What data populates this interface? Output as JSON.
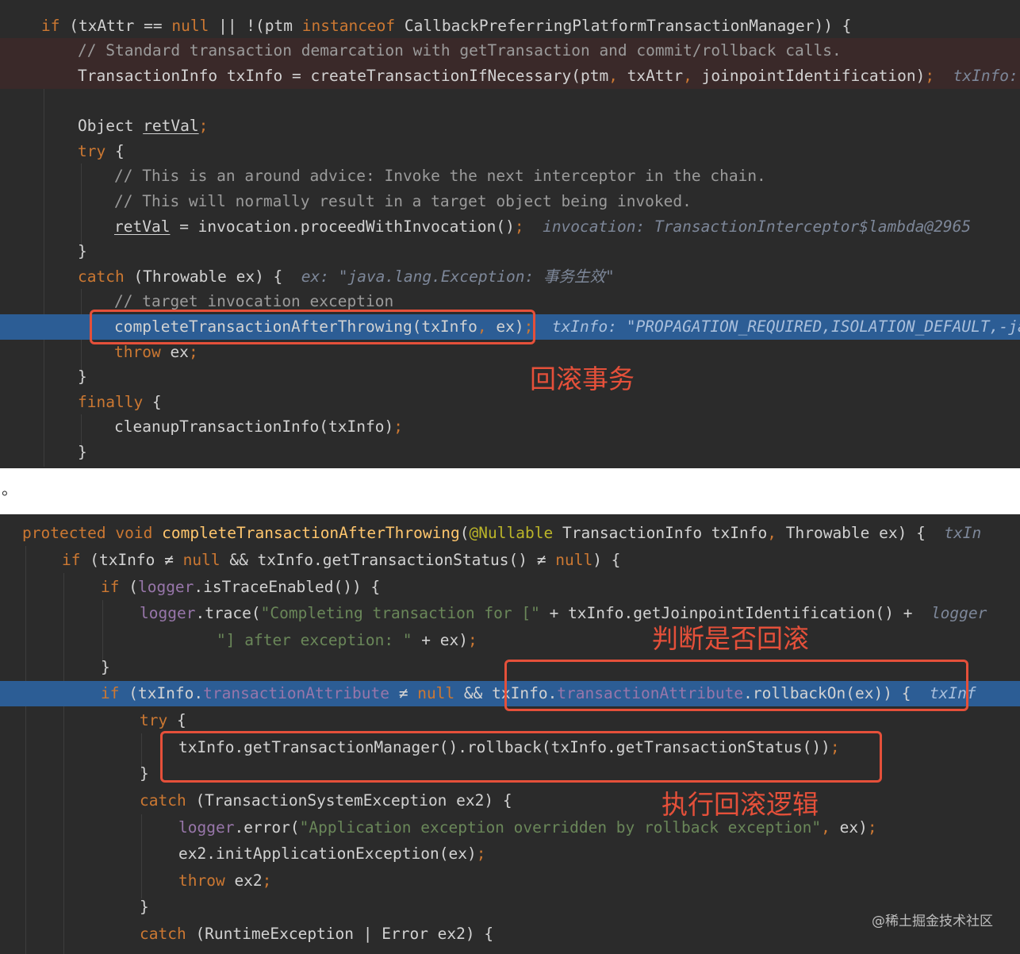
{
  "top_panel": {
    "lines": [
      [
        {
          "t": "if",
          "c": "kw"
        },
        {
          "t": " (txAttr == "
        },
        {
          "t": "null",
          "c": "kw"
        },
        {
          "t": " || !(ptm "
        },
        {
          "t": "instanceof",
          "c": "kw"
        },
        {
          "t": " CallbackPreferringPlatformTransactionManager)) {"
        }
      ],
      [
        {
          "t": "// Standard transaction demarcation with getTransaction and commit/rollback calls.",
          "c": "cm"
        }
      ],
      [
        {
          "t": "TransactionInfo txInfo = createTransactionIfNecessary(ptm"
        },
        {
          "t": ",",
          "c": "kw"
        },
        {
          "t": " txAttr"
        },
        {
          "t": ",",
          "c": "kw"
        },
        {
          "t": " joinpointIdentification)"
        },
        {
          "t": ";",
          "c": "kw"
        },
        {
          "t": "  txInfo: \"",
          "c": "hint"
        }
      ],
      [],
      [
        {
          "t": "Object "
        },
        {
          "t": "retVal",
          "c": "ul"
        },
        {
          "t": ";",
          "c": "kw"
        }
      ],
      [
        {
          "t": "try",
          "c": "kw"
        },
        {
          "t": " {"
        }
      ],
      [
        {
          "t": "// This is an around advice: Invoke the next interceptor in the chain.",
          "c": "cm"
        }
      ],
      [
        {
          "t": "// This will normally result in a target object being invoked.",
          "c": "cm"
        }
      ],
      [
        {
          "t": "retVal",
          "c": "ul"
        },
        {
          "t": " = invocation.proceedWithInvocation()"
        },
        {
          "t": ";",
          "c": "kw"
        },
        {
          "t": "  invocation: TransactionInterceptor$lambda@2965",
          "c": "hint"
        }
      ],
      [
        {
          "t": "}"
        }
      ],
      [
        {
          "t": "catch",
          "c": "kw"
        },
        {
          "t": " (Throwable ex) {  "
        },
        {
          "t": "ex: \"java.lang.Exception: 事务生效\"",
          "c": "hint"
        }
      ],
      [
        {
          "t": "// target invocation exception",
          "c": "cm"
        }
      ],
      [
        {
          "t": "completeTransactionAfterThrowing(txInfo"
        },
        {
          "t": ",",
          "c": "kw"
        },
        {
          "t": " ex)"
        },
        {
          "t": ";",
          "c": "kw"
        },
        {
          "t": "  txInfo: \"PROPAGATION_REQUIRED,ISOLATION_DEFAULT,-java",
          "c": "hint"
        }
      ],
      [
        {
          "t": "throw",
          "c": "kw"
        },
        {
          "t": " ex"
        },
        {
          "t": ";",
          "c": "kw"
        }
      ],
      [
        {
          "t": "}"
        }
      ],
      [
        {
          "t": "finally",
          "c": "kw"
        },
        {
          "t": " {"
        }
      ],
      [
        {
          "t": "cleanupTransactionInfo(txInfo)"
        },
        {
          "t": ";",
          "c": "kw"
        }
      ],
      [
        {
          "t": "}"
        }
      ]
    ]
  },
  "separator": "。",
  "bottom_panel": {
    "lines": [
      [
        {
          "t": "protected void ",
          "c": "kw"
        },
        {
          "t": "completeTransactionAfterThrowing",
          "c": "fn"
        },
        {
          "t": "("
        },
        {
          "t": "@Nullable",
          "c": "an"
        },
        {
          "t": " TransactionInfo txInfo"
        },
        {
          "t": ",",
          "c": "kw"
        },
        {
          "t": " Throwable ex) {  "
        },
        {
          "t": "txIn",
          "c": "hint"
        }
      ],
      [
        {
          "t": "if",
          "c": "kw"
        },
        {
          "t": " (txInfo ≠ "
        },
        {
          "t": "null",
          "c": "kw"
        },
        {
          "t": " && txInfo.getTransactionStatus() ≠ "
        },
        {
          "t": "null",
          "c": "kw"
        },
        {
          "t": ") {"
        }
      ],
      [
        {
          "t": "if",
          "c": "kw"
        },
        {
          "t": " ("
        },
        {
          "t": "logger",
          "c": "fld"
        },
        {
          "t": ".isTraceEnabled()) {"
        }
      ],
      [
        {
          "t": "logger",
          "c": "fld"
        },
        {
          "t": ".trace("
        },
        {
          "t": "\"Completing transaction for [\"",
          "c": "str"
        },
        {
          "t": " + txInfo.getJoinpointIdentification() +  "
        },
        {
          "t": "logger",
          "c": "hint"
        }
      ],
      [
        {
          "t": "\"] after exception: \"",
          "c": "str"
        },
        {
          "t": " + ex)"
        },
        {
          "t": ";",
          "c": "kw"
        }
      ],
      [
        {
          "t": "}"
        }
      ],
      [
        {
          "t": "if",
          "c": "kw"
        },
        {
          "t": " (txInfo."
        },
        {
          "t": "transactionAttribute",
          "c": "fld"
        },
        {
          "t": " ≠ "
        },
        {
          "t": "null",
          "c": "kw"
        },
        {
          "t": " && txInfo."
        },
        {
          "t": "transactionAttribute",
          "c": "fld"
        },
        {
          "t": ".rollbackOn(ex)) {  "
        },
        {
          "t": "txInf",
          "c": "hint"
        }
      ],
      [
        {
          "t": "try",
          "c": "kw"
        },
        {
          "t": " {"
        }
      ],
      [
        {
          "t": "txInfo.getTransactionManager().rollback(txInfo.getTransactionStatus())"
        },
        {
          "t": ";",
          "c": "kw"
        }
      ],
      [
        {
          "t": "}"
        }
      ],
      [
        {
          "t": "catch",
          "c": "kw"
        },
        {
          "t": " (TransactionSystemException ex2) {"
        }
      ],
      [
        {
          "t": "logger",
          "c": "fld"
        },
        {
          "t": ".error("
        },
        {
          "t": "\"Application exception overridden by rollback exception\"",
          "c": "str"
        },
        {
          "t": ",",
          "c": "kw"
        },
        {
          "t": " ex)"
        },
        {
          "t": ";",
          "c": "kw"
        }
      ],
      [
        {
          "t": "ex2.initApplicationException(ex)"
        },
        {
          "t": ";",
          "c": "kw"
        }
      ],
      [
        {
          "t": "throw",
          "c": "kw"
        },
        {
          "t": " ex2"
        },
        {
          "t": ";",
          "c": "kw"
        }
      ],
      [
        {
          "t": "}"
        }
      ],
      [
        {
          "t": "catch",
          "c": "kw"
        },
        {
          "t": " (RuntimeException | Error ex2) {"
        }
      ]
    ]
  },
  "annotations": {
    "rollback_transaction": "回滚事务",
    "check_rollback": "判断是否回滚",
    "execute_rollback_logic": "执行回滚逻辑"
  },
  "watermark": "@稀土掘金技术社区",
  "colors": {
    "editor_bg": "#2b2b2b",
    "keyword": "#cc7832",
    "comment": "#9b9b9b",
    "method_decl": "#ffc66d",
    "string": "#6a8759",
    "field": "#9876aa",
    "annotation": "#bbb529",
    "inline_hint": "#7d8799",
    "current_line": "#2c5d95",
    "annotation_red": "#e5503a"
  }
}
